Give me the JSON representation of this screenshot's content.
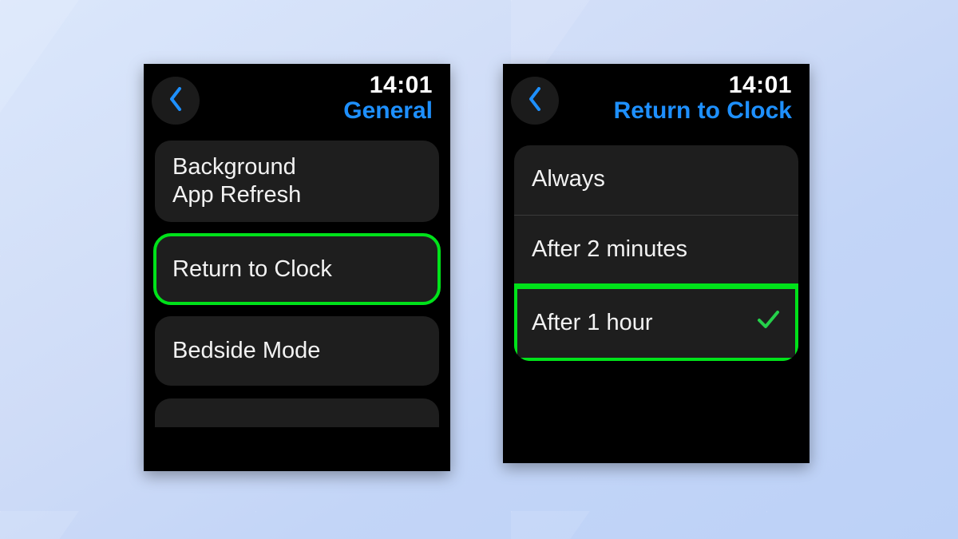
{
  "colors": {
    "accent_blue": "#1e90ff",
    "highlight_green": "#00e21a"
  },
  "left": {
    "time": "14:01",
    "title": "General",
    "items": [
      {
        "label": "Background\nApp Refresh",
        "highlighted": false
      },
      {
        "label": "Return to Clock",
        "highlighted": true
      },
      {
        "label": "Bedside Mode",
        "highlighted": false
      }
    ]
  },
  "right": {
    "time": "14:01",
    "title": "Return to Clock",
    "options": [
      {
        "label": "Always",
        "selected": false,
        "highlighted": false
      },
      {
        "label": "After 2 minutes",
        "selected": false,
        "highlighted": false
      },
      {
        "label": "After 1 hour",
        "selected": true,
        "highlighted": true
      }
    ]
  }
}
